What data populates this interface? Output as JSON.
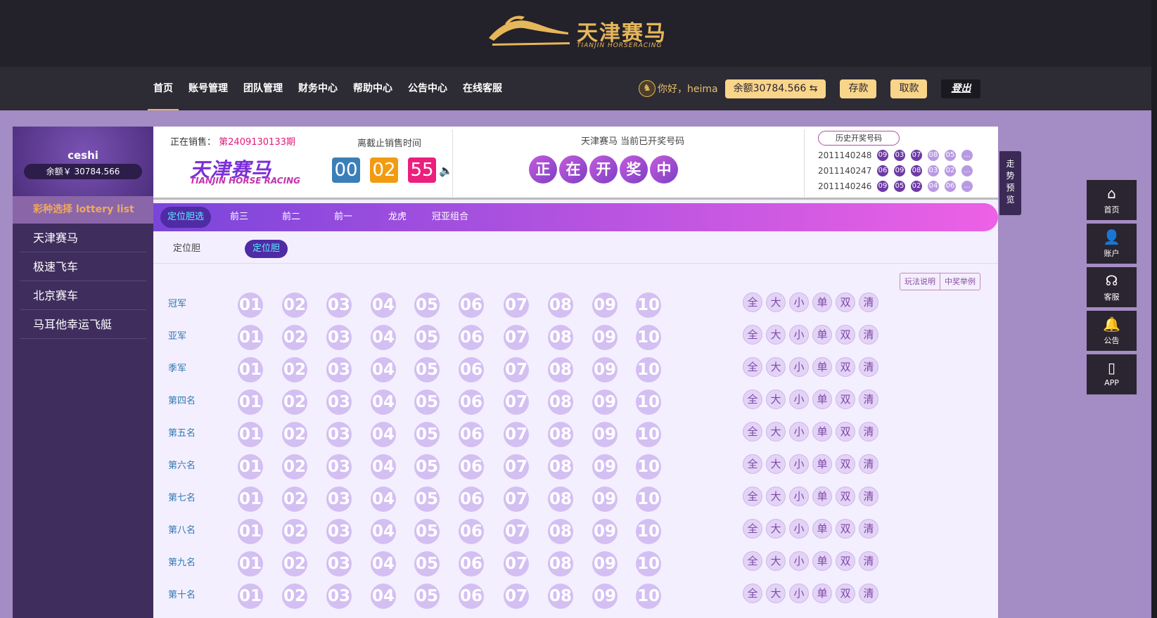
{
  "header": {
    "logo_cn": "天津赛马",
    "logo_en": "TIANJIN HORSERACING"
  },
  "nav": {
    "items": [
      "首页",
      "账号管理",
      "团队管理",
      "财务中心",
      "帮助中心",
      "公告中心",
      "在线客服"
    ],
    "greeting": "你好，heima",
    "balance": "余额30784.566 ⇆",
    "deposit": "存款",
    "withdraw": "取款",
    "logout": "登出"
  },
  "sidebar": {
    "username": "ceshi",
    "balance": "余额￥ 30784.566",
    "heading": "彩种选择 lottery list",
    "items": [
      "天津赛马",
      "极速飞车",
      "北京赛车",
      "马耳他幸运飞艇"
    ]
  },
  "info": {
    "onsale_label": "正在销售：",
    "period": "第2409130133期",
    "brand_cn": "天津赛马",
    "brand_en": "TIANJIN HORSE RACING",
    "deadline_label": "离截止销售时间",
    "timer": [
      "00",
      "02",
      "55"
    ],
    "draw_title": "天津赛马 当前已开奖号码",
    "drawing": [
      "正",
      "在",
      "开",
      "奖",
      "中"
    ],
    "history_button": "历史开奖号码",
    "history": [
      {
        "no": "2011140248",
        "balls": [
          "09",
          "03",
          "07",
          "08",
          "05",
          "..."
        ]
      },
      {
        "no": "2011140247",
        "balls": [
          "06",
          "09",
          "08",
          "03",
          "02",
          "..."
        ]
      },
      {
        "no": "2011140246",
        "balls": [
          "09",
          "05",
          "02",
          "04",
          "06",
          "..."
        ]
      }
    ]
  },
  "tabs": [
    "定位胆选",
    "前三",
    "前二",
    "前一",
    "龙虎",
    "冠亚组合"
  ],
  "subtabs": [
    "定位胆",
    "定位胆"
  ],
  "rules": {
    "play": "玩法说明",
    "example": "中奖举例"
  },
  "rows": [
    "冠军",
    "亚军",
    "季军",
    "第四名",
    "第五名",
    "第六名",
    "第七名",
    "第八名",
    "第九名",
    "第十名"
  ],
  "numbers": [
    "01",
    "02",
    "03",
    "04",
    "05",
    "06",
    "07",
    "08",
    "09",
    "10"
  ],
  "quick": [
    "全",
    "大",
    "小",
    "单",
    "双",
    "清"
  ],
  "trend": "走势预览",
  "right_nav": [
    {
      "icon": "home-icon",
      "label": "首页"
    },
    {
      "icon": "user-icon",
      "label": "账户"
    },
    {
      "icon": "headset-icon",
      "label": "客服"
    },
    {
      "icon": "bell-icon",
      "label": "公告"
    },
    {
      "icon": "phone-icon",
      "label": "APP"
    }
  ]
}
